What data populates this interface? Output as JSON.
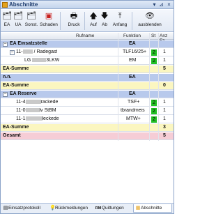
{
  "window": {
    "title": "Abschnitte"
  },
  "toolbar": {
    "items": [
      {
        "label": "EA",
        "icon": "ea-icon"
      },
      {
        "label": "UA",
        "icon": "ua-icon"
      },
      {
        "label": "Sonst.",
        "icon": "sonst-icon"
      },
      {
        "label": "Schaden",
        "icon": "schaden-icon"
      },
      {
        "label": "Druck",
        "icon": "printer-icon"
      },
      {
        "label": "Auf",
        "icon": "arrow-up-icon"
      },
      {
        "label": "Ab",
        "icon": "arrow-down-icon"
      },
      {
        "label": "Anfang",
        "icon": "arrow-top-icon"
      },
      {
        "label": "ausblenden",
        "icon": "eye-icon"
      }
    ]
  },
  "grid": {
    "headers": {
      "rufname": "Rufname",
      "funktion": "Funktion",
      "st": "St",
      "anz": "Anz Fz"
    },
    "rows": {
      "r1": {
        "name": "EA Einsatzstelle",
        "funktion": "EA"
      },
      "r2": {
        "name": "11-",
        "name_tail": "/ Radegast",
        "funktion": "TLF16/25+",
        "st": "2",
        "anz": "1"
      },
      "r3": {
        "name": "LG ",
        "name_tail": "3LKW",
        "funktion": "EM",
        "st": "2",
        "anz": "1"
      },
      "r4": {
        "name": "EA-Summe",
        "anz": "5"
      },
      "r5": {
        "name": "n.n.",
        "funktion": "EA"
      },
      "r6": {
        "name": "EA-Summe",
        "anz": "0"
      },
      "r7": {
        "name": "EA Reserve",
        "funktion": "EA"
      },
      "r8": {
        "name": "11-4",
        "name_tail": "rackede",
        "funktion": "TSF+",
        "st": "2",
        "anz": "1"
      },
      "r9": {
        "name": "11-0",
        "name_tail": "lv StBM",
        "funktion": "tbrandmeis",
        "st": "2",
        "anz": "1"
      },
      "r10": {
        "name": "11-1",
        "name_tail": "leckede",
        "funktion": "MTW+",
        "st": "2",
        "anz": "1"
      },
      "r11": {
        "name": "EA-Summe",
        "anz": "3"
      },
      "r12": {
        "name": "Gesamt",
        "anz": "5"
      }
    }
  },
  "tabs": [
    {
      "label": "Einsatzprotokoll",
      "icon": "log-icon"
    },
    {
      "label": "Rückmeldungen",
      "icon": "bulb-icon"
    },
    {
      "label": "Quittungen",
      "icon": "rm-icon"
    },
    {
      "label": "Abschnitte",
      "icon": "sections-icon"
    }
  ],
  "colors": {
    "group": "#b8c9ec",
    "sum": "#fbf6c0",
    "total": "#f6cdd6",
    "status_green": "#22c024"
  }
}
